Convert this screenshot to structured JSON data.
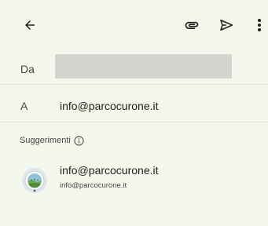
{
  "toolbar": {
    "back_icon": "arrow-left-icon",
    "attach_icon": "paperclip-icon",
    "send_icon": "send-icon",
    "more_icon": "more-vert-icon"
  },
  "compose": {
    "from_label": "Da",
    "from_value": "",
    "to_label": "A",
    "to_value": "info@parcocurone.it"
  },
  "suggestions": {
    "header": "Suggerimenti",
    "info_icon": "info-icon",
    "items": [
      {
        "name": "info@parcocurone.it",
        "email": "info@parcocurone.it",
        "avatar": "park-logo-avatar"
      }
    ]
  },
  "colors": {
    "background": "#f4f8ec",
    "divider": "#e1e5d8",
    "redacted_field": "#d3d5d1",
    "text_primary": "#1f1f1f",
    "text_secondary": "#444746"
  }
}
